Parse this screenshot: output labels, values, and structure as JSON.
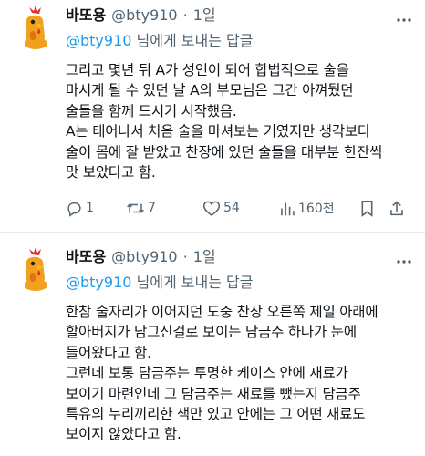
{
  "tweets": [
    {
      "author_name": "바또용",
      "handle": "@bty910",
      "dot": "·",
      "time": "1일",
      "reply_mention": "@bty910",
      "reply_suffix": " 님에게 보내는 답글",
      "paragraphs": [
        "그리고 몇년 뒤 A가 성인이 되어 합법적으로 술을\n마시게 될 수 있던 날 A의 부모님은 그간 아껴뒀던\n술들을 함께 드시기 시작했음.",
        "A는 태어나서 처음 술을 마셔보는 거였지만 생각보다\n술이 몸에 잘 받았고 찬장에 있던 술들을 대부분 한잔씩\n맛 보았다고 함."
      ],
      "stats": {
        "replies": "1",
        "retweets": "7",
        "likes": "54",
        "views": "160천"
      }
    },
    {
      "author_name": "바또용",
      "handle": "@bty910",
      "dot": "·",
      "time": "1일",
      "reply_mention": "@bty910",
      "reply_suffix": " 님에게 보내는 답글",
      "paragraphs": [
        "한참 술자리가 이어지던 도중 찬장 오른쪽 제일 아래에\n할아버지가 담그신걸로 보이는 담금주 하나가 눈에\n들어왔다고 함.",
        "그런데 보통 담금주는 투명한 케이스 안에 재료가\n보이기 마련인데 그 담금주는 재료를 뺐는지 담금주\n특유의 누리끼리한 색만 있고 안에는 그 어떤 재료도\n보이지 않았다고 함."
      ]
    }
  ],
  "icons": {
    "reply": "reply-icon",
    "retweet": "retweet-icon",
    "like": "heart-icon",
    "views": "views-icon",
    "bookmark": "bookmark-icon",
    "share": "share-icon",
    "more": "more-icon"
  },
  "colors": {
    "mention": "#1d9bf0",
    "muted": "#536471",
    "text": "#0f1419"
  }
}
